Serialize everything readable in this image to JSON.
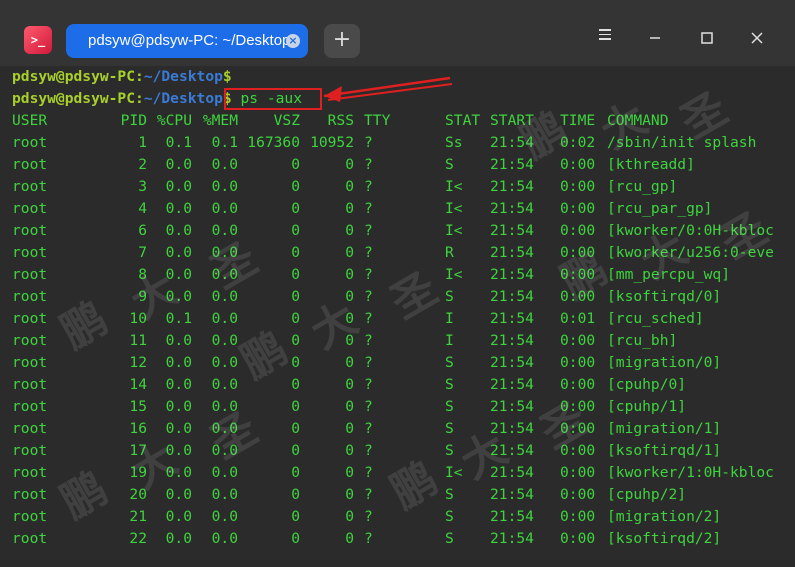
{
  "window": {
    "tab_title": "pdsyw@pdsyw-PC: ~/Desktop",
    "tab_close": "×",
    "new_tab": "+",
    "app_icon": "terminal-icon",
    "controls": [
      "menu-icon",
      "minimize-icon",
      "maximize-icon",
      "close-icon"
    ]
  },
  "prompts": [
    {
      "user": "pdsyw@pdsyw-PC",
      "sep": ":",
      "path": "~/Desktop",
      "sigil": "$",
      "command": ""
    },
    {
      "user": "pdsyw@pdsyw-PC",
      "sep": ":",
      "path": "~/Desktop",
      "sigil": "$",
      "command": " ps -aux"
    }
  ],
  "header": {
    "user": "USER",
    "pid": "PID",
    "cpu": "%CPU",
    "mem": "%MEM",
    "vsz": "VSZ",
    "rss": "RSS",
    "tty": "TTY",
    "stat": "STAT",
    "start": "START",
    "time": "TIME",
    "command": "COMMAND"
  },
  "rows": [
    {
      "user": "root",
      "pid": "1",
      "cpu": "0.1",
      "mem": "0.1",
      "vsz": "167360",
      "rss": "10952",
      "tty": "?",
      "stat": "Ss",
      "start": "21:54",
      "time": "0:02",
      "command": "/sbin/init splash"
    },
    {
      "user": "root",
      "pid": "2",
      "cpu": "0.0",
      "mem": "0.0",
      "vsz": "0",
      "rss": "0",
      "tty": "?",
      "stat": "S",
      "start": "21:54",
      "time": "0:00",
      "command": "[kthreadd]"
    },
    {
      "user": "root",
      "pid": "3",
      "cpu": "0.0",
      "mem": "0.0",
      "vsz": "0",
      "rss": "0",
      "tty": "?",
      "stat": "I<",
      "start": "21:54",
      "time": "0:00",
      "command": "[rcu_gp]"
    },
    {
      "user": "root",
      "pid": "4",
      "cpu": "0.0",
      "mem": "0.0",
      "vsz": "0",
      "rss": "0",
      "tty": "?",
      "stat": "I<",
      "start": "21:54",
      "time": "0:00",
      "command": "[rcu_par_gp]"
    },
    {
      "user": "root",
      "pid": "6",
      "cpu": "0.0",
      "mem": "0.0",
      "vsz": "0",
      "rss": "0",
      "tty": "?",
      "stat": "I<",
      "start": "21:54",
      "time": "0:00",
      "command": "[kworker/0:0H-kbloc"
    },
    {
      "user": "root",
      "pid": "7",
      "cpu": "0.0",
      "mem": "0.0",
      "vsz": "0",
      "rss": "0",
      "tty": "?",
      "stat": "R",
      "start": "21:54",
      "time": "0:00",
      "command": "[kworker/u256:0-eve"
    },
    {
      "user": "root",
      "pid": "8",
      "cpu": "0.0",
      "mem": "0.0",
      "vsz": "0",
      "rss": "0",
      "tty": "?",
      "stat": "I<",
      "start": "21:54",
      "time": "0:00",
      "command": "[mm_percpu_wq]"
    },
    {
      "user": "root",
      "pid": "9",
      "cpu": "0.0",
      "mem": "0.0",
      "vsz": "0",
      "rss": "0",
      "tty": "?",
      "stat": "S",
      "start": "21:54",
      "time": "0:00",
      "command": "[ksoftirqd/0]"
    },
    {
      "user": "root",
      "pid": "10",
      "cpu": "0.1",
      "mem": "0.0",
      "vsz": "0",
      "rss": "0",
      "tty": "?",
      "stat": "I",
      "start": "21:54",
      "time": "0:01",
      "command": "[rcu_sched]"
    },
    {
      "user": "root",
      "pid": "11",
      "cpu": "0.0",
      "mem": "0.0",
      "vsz": "0",
      "rss": "0",
      "tty": "?",
      "stat": "I",
      "start": "21:54",
      "time": "0:00",
      "command": "[rcu_bh]"
    },
    {
      "user": "root",
      "pid": "12",
      "cpu": "0.0",
      "mem": "0.0",
      "vsz": "0",
      "rss": "0",
      "tty": "?",
      "stat": "S",
      "start": "21:54",
      "time": "0:00",
      "command": "[migration/0]"
    },
    {
      "user": "root",
      "pid": "14",
      "cpu": "0.0",
      "mem": "0.0",
      "vsz": "0",
      "rss": "0",
      "tty": "?",
      "stat": "S",
      "start": "21:54",
      "time": "0:00",
      "command": "[cpuhp/0]"
    },
    {
      "user": "root",
      "pid": "15",
      "cpu": "0.0",
      "mem": "0.0",
      "vsz": "0",
      "rss": "0",
      "tty": "?",
      "stat": "S",
      "start": "21:54",
      "time": "0:00",
      "command": "[cpuhp/1]"
    },
    {
      "user": "root",
      "pid": "16",
      "cpu": "0.0",
      "mem": "0.0",
      "vsz": "0",
      "rss": "0",
      "tty": "?",
      "stat": "S",
      "start": "21:54",
      "time": "0:00",
      "command": "[migration/1]"
    },
    {
      "user": "root",
      "pid": "17",
      "cpu": "0.0",
      "mem": "0.0",
      "vsz": "0",
      "rss": "0",
      "tty": "?",
      "stat": "S",
      "start": "21:54",
      "time": "0:00",
      "command": "[ksoftirqd/1]"
    },
    {
      "user": "root",
      "pid": "19",
      "cpu": "0.0",
      "mem": "0.0",
      "vsz": "0",
      "rss": "0",
      "tty": "?",
      "stat": "I<",
      "start": "21:54",
      "time": "0:00",
      "command": "[kworker/1:0H-kbloc"
    },
    {
      "user": "root",
      "pid": "20",
      "cpu": "0.0",
      "mem": "0.0",
      "vsz": "0",
      "rss": "0",
      "tty": "?",
      "stat": "S",
      "start": "21:54",
      "time": "0:00",
      "command": "[cpuhp/2]"
    },
    {
      "user": "root",
      "pid": "21",
      "cpu": "0.0",
      "mem": "0.0",
      "vsz": "0",
      "rss": "0",
      "tty": "?",
      "stat": "S",
      "start": "21:54",
      "time": "0:00",
      "command": "[migration/2]"
    },
    {
      "user": "root",
      "pid": "22",
      "cpu": "0.0",
      "mem": "0.0",
      "vsz": "0",
      "rss": "0",
      "tty": "?",
      "stat": "S",
      "start": "21:54",
      "time": "0:00",
      "command": "[ksoftirqd/2]"
    }
  ],
  "watermark": [
    "鹏",
    "大",
    "圣"
  ],
  "colors": {
    "accent": "#1d6ce8",
    "terminal_text": "#3ed43e",
    "prompt_user": "#8bc34a",
    "prompt_path": "#3a7bd5",
    "annotation": "#e02020",
    "background": "#2b2b2b"
  }
}
